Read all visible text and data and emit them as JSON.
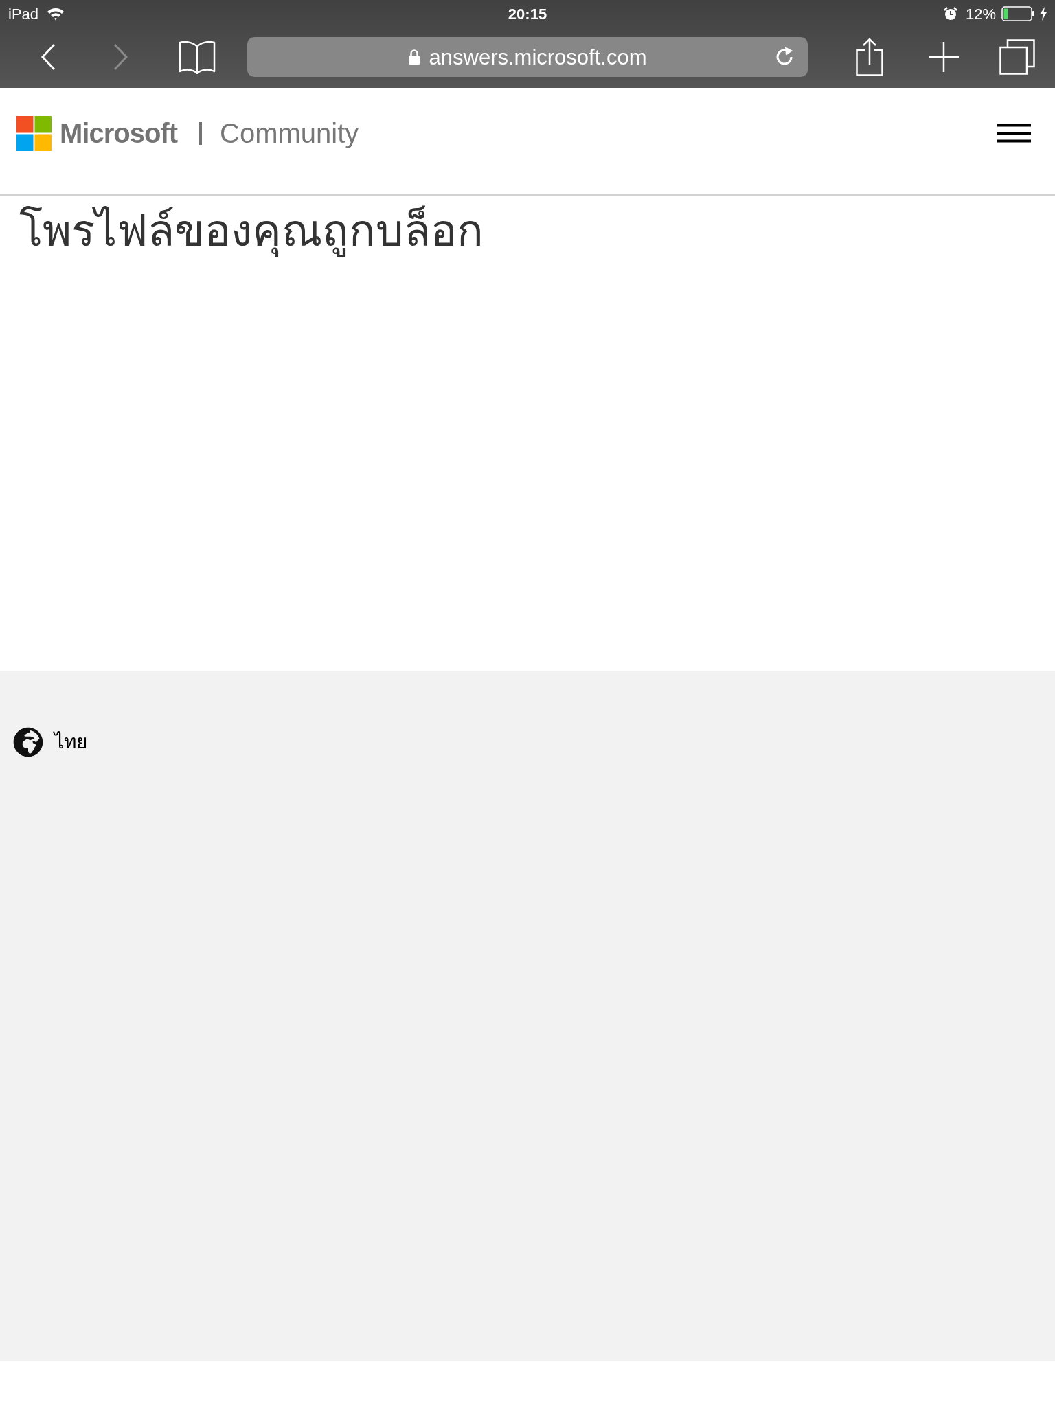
{
  "status_bar": {
    "device": "iPad",
    "time": "20:15",
    "battery": "12%"
  },
  "browser": {
    "nav_buttons": [
      {
        "kind": "back",
        "disabled": false
      },
      {
        "kind": "forward",
        "disabled": true
      }
    ],
    "address": "answers.microsoft.com"
  },
  "site_header": {
    "brand": "Microsoft",
    "section": "Community"
  },
  "page": {
    "title": "โพรไฟล์ของคุณถูกบล็อก"
  },
  "footer": {
    "language": "ไทย"
  }
}
